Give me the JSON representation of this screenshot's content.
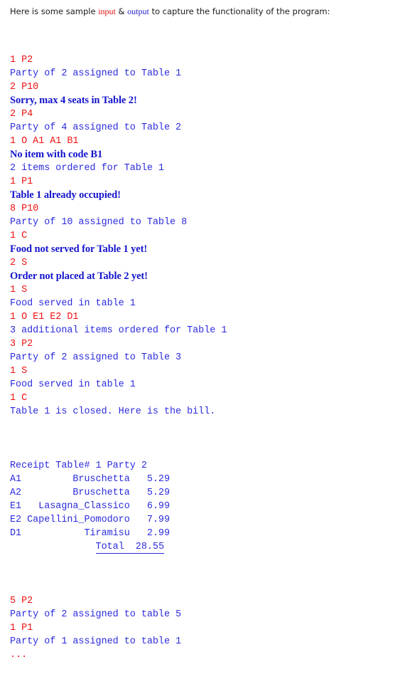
{
  "intro": {
    "before": "Here is some sample ",
    "input_word": "input",
    "middle": " & ",
    "output_word": "output",
    "after": " to capture the functionality of the program:"
  },
  "colors": {
    "input": "#ee1111",
    "output": "#2b2bdd",
    "error": "#1414cc",
    "background": "#ffffff",
    "intro_text": "#1a1a1a"
  },
  "transcript": [
    {
      "kind": "input",
      "text": "1 P2"
    },
    {
      "kind": "output",
      "text": "Party of 2 assigned to Table 1"
    },
    {
      "kind": "input",
      "text": "2 P10"
    },
    {
      "kind": "error",
      "text": "Sorry, max 4 seats in Table 2!"
    },
    {
      "kind": "input",
      "text": "2 P4"
    },
    {
      "kind": "output",
      "text": "Party of 4 assigned to Table 2"
    },
    {
      "kind": "input",
      "text": "1 O A1 A1 B1"
    },
    {
      "kind": "error",
      "text": "No item with code B1"
    },
    {
      "kind": "output",
      "text": "2 items ordered for Table 1"
    },
    {
      "kind": "input",
      "text": "1 P1"
    },
    {
      "kind": "error",
      "text": "Table 1 already occupied!"
    },
    {
      "kind": "input",
      "text": "8 P10"
    },
    {
      "kind": "output",
      "text": "Party of 10 assigned to Table 8"
    },
    {
      "kind": "input",
      "text": "1 C"
    },
    {
      "kind": "error",
      "text": "Food not served for Table 1 yet!"
    },
    {
      "kind": "input",
      "text": "2 S"
    },
    {
      "kind": "error",
      "text": "Order not placed at Table 2 yet!"
    },
    {
      "kind": "input",
      "text": "1 S"
    },
    {
      "kind": "output",
      "text": "Food served in table 1"
    },
    {
      "kind": "input",
      "text": "1 O E1 E2 D1"
    },
    {
      "kind": "output",
      "text": "3 additional items ordered for Table 1"
    },
    {
      "kind": "input",
      "text": "3 P2"
    },
    {
      "kind": "output",
      "text": "Party of 2 assigned to Table 3"
    },
    {
      "kind": "input",
      "text": "1 S"
    },
    {
      "kind": "output",
      "text": "Food served in table 1"
    },
    {
      "kind": "input",
      "text": "1 C"
    },
    {
      "kind": "output",
      "text": "Table 1 is closed. Here is the bill."
    },
    {
      "kind": "blank",
      "text": ""
    }
  ],
  "receipt": {
    "header": "Receipt Table# 1 Party 2",
    "items": [
      {
        "code": "A1",
        "name": "Bruschetta",
        "price": "5.29"
      },
      {
        "code": "A2",
        "name": "Bruschetta",
        "price": "5.29"
      },
      {
        "code": "E1",
        "name": "Lasagna_Classico",
        "price": "6.99"
      },
      {
        "code": "E2",
        "name": "Capellini_Pomodoro",
        "price": "7.99"
      },
      {
        "code": "D1",
        "name": "Tiramisu",
        "price": "2.99"
      }
    ],
    "total_label": "Total",
    "total_value": "28.55"
  },
  "transcript_tail": [
    {
      "kind": "blank",
      "text": ""
    },
    {
      "kind": "input",
      "text": "5 P2"
    },
    {
      "kind": "output",
      "text": "Party of 2 assigned to table 5"
    },
    {
      "kind": "input",
      "text": "1 P1"
    },
    {
      "kind": "output",
      "text": "Party of 1 assigned to table 1"
    },
    {
      "kind": "input",
      "text": "..."
    }
  ]
}
